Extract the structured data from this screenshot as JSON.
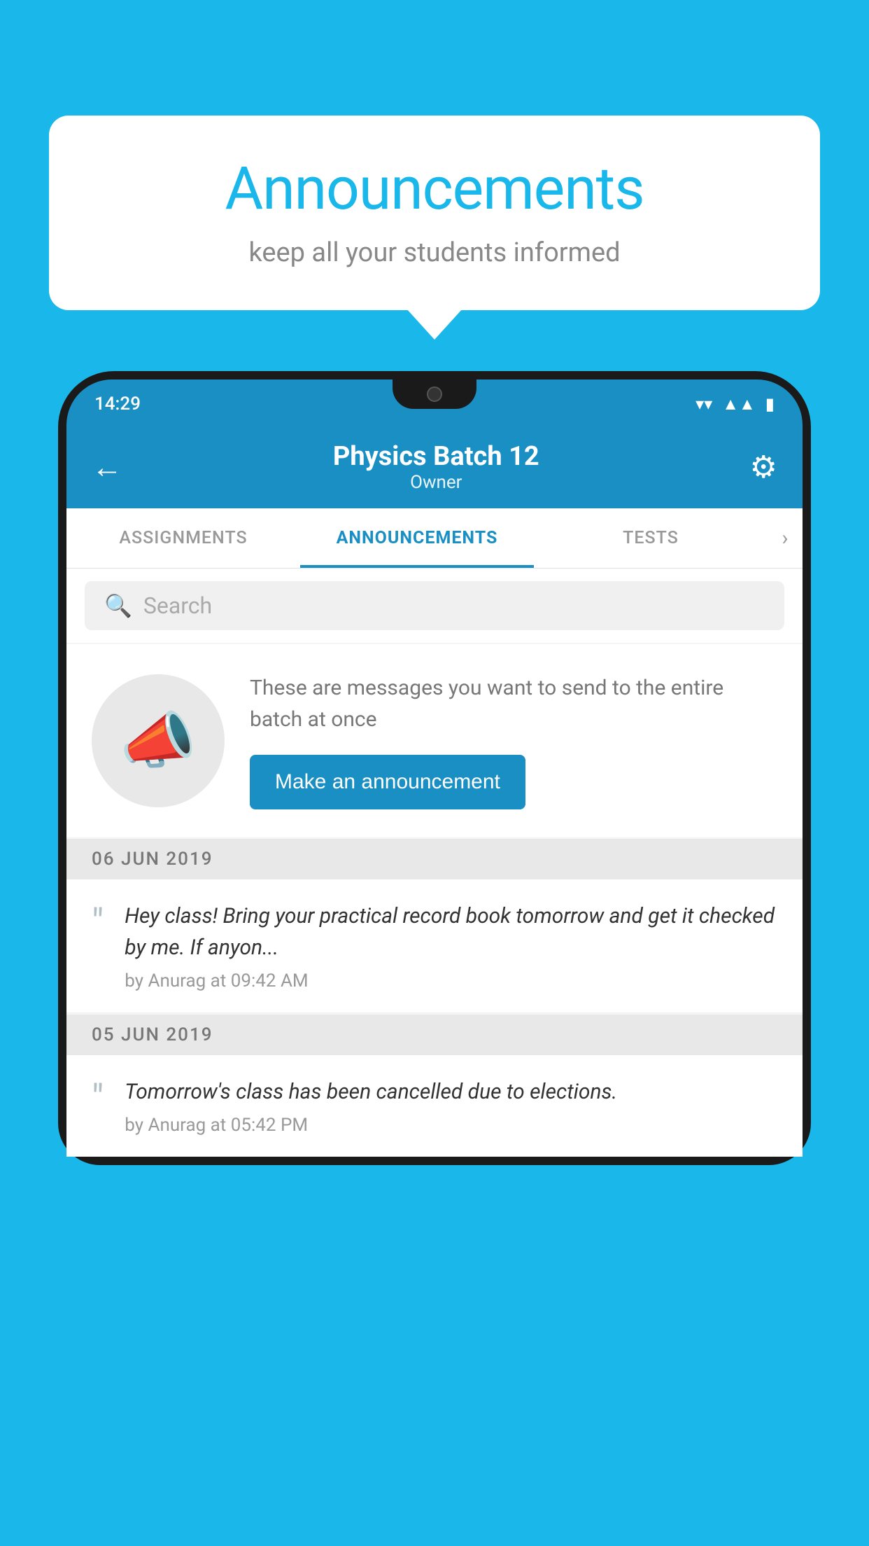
{
  "background_color": "#1ab7ea",
  "speech_bubble": {
    "title": "Announcements",
    "subtitle": "keep all your students informed"
  },
  "phone": {
    "status_bar": {
      "time": "14:29",
      "wifi_icon": "wifi",
      "signal_icon": "signal",
      "battery_icon": "battery"
    },
    "header": {
      "back_label": "←",
      "title": "Physics Batch 12",
      "subtitle": "Owner",
      "gear_label": "⚙"
    },
    "tabs": [
      {
        "label": "ASSIGNMENTS",
        "active": false
      },
      {
        "label": "ANNOUNCEMENTS",
        "active": true
      },
      {
        "label": "TESTS",
        "active": false
      }
    ],
    "search": {
      "placeholder": "Search"
    },
    "promo": {
      "description": "These are messages you want to send to the entire batch at once",
      "button_label": "Make an announcement"
    },
    "announcements": [
      {
        "date": "06  JUN  2019",
        "text": "Hey class! Bring your practical record book tomorrow and get it checked by me. If anyon...",
        "author": "by Anurag at 09:42 AM"
      },
      {
        "date": "05  JUN  2019",
        "text": "Tomorrow's class has been cancelled due to elections.",
        "author": "by Anurag at 05:42 PM"
      }
    ]
  }
}
